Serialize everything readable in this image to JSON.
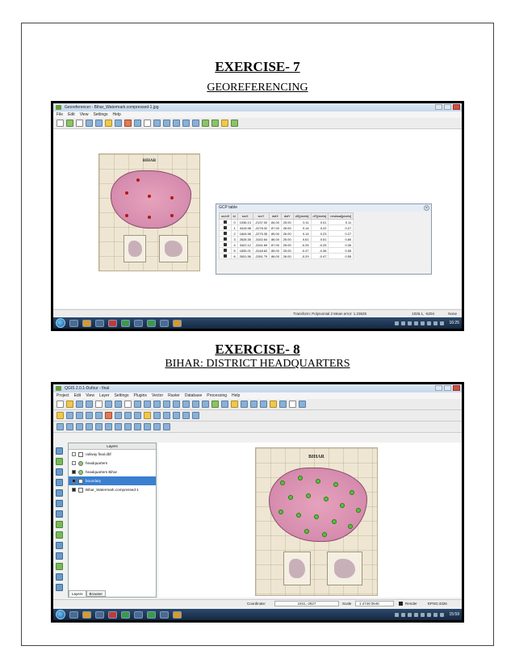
{
  "exercise7": {
    "title": "EXERCISE- 7",
    "subtitle": "GEOREFERENCING",
    "window_title": "Georeferencer - Bihar_Watermark.compressed-1.jpg",
    "menu": [
      "File",
      "Edit",
      "View",
      "Settings",
      "Help"
    ],
    "map": {
      "heading": "BIHAR"
    },
    "gcp_table": {
      "title": "GCP table",
      "columns": [
        "on/off",
        "id",
        "srcX",
        "srcY",
        "dstX",
        "dstY",
        "dX[pixels]",
        "dY[pixels]",
        "residual[pixels]"
      ],
      "rows": [
        [
          "0",
          "1036.13",
          "-2137.00",
          "84.00",
          "25.00",
          "0.11",
          "0.01",
          "0.11"
        ],
        [
          "1",
          "3415.98",
          "-2278.32",
          "87.00",
          "26.00",
          "0.14",
          "0.22",
          "0.27"
        ],
        [
          "2",
          "1844.98",
          "-2275.35",
          "85.00",
          "26.00",
          "0.14",
          "0.23",
          "0.27"
        ],
        [
          "3",
          "2628.35",
          "-3152.64",
          "86.00",
          "25.00",
          "0.61",
          "0.51",
          "0.80"
        ],
        [
          "4",
          "3422.12",
          "-3151.69",
          "87.00",
          "25.00",
          "-0.25",
          "-0.25",
          "0.35"
        ],
        [
          "5",
          "1835.21",
          "-3148.62",
          "85.00",
          "25.00",
          "-0.47",
          "-0.38",
          "0.55"
        ],
        [
          "6",
          "2631.56",
          "-2281.79",
          "86.00",
          "26.00",
          "-0.29",
          "-0.47",
          "0.55"
        ]
      ]
    },
    "status": {
      "transform": "Transform: Polynomial 2 Mean error: 1.23625",
      "coords": "1026.1, -5204",
      "crs": "None"
    },
    "clock": "16:25"
  },
  "exercise8": {
    "title": "EXERCISE- 8",
    "subtitle": "BIHAR: DISTRICT HEADQUARTERS",
    "window_title": "QGIS 2.0.1-Dufour - final",
    "menu": [
      "Project",
      "Edit",
      "View",
      "Layer",
      "Settings",
      "Plugins",
      "Vector",
      "Raster",
      "Database",
      "Processing",
      "Help"
    ],
    "layers_panel": {
      "title": "Layers",
      "layers": [
        {
          "name": "railway final.dbf",
          "checked": false,
          "selected": false
        },
        {
          "name": "headquarters",
          "checked": false,
          "selected": false
        },
        {
          "name": "headquarters Bihar",
          "checked": true,
          "selected": false
        },
        {
          "name": "boundary",
          "checked": true,
          "selected": true
        },
        {
          "name": "Bihar_Watermark.compressed-1",
          "checked": true,
          "selected": false
        }
      ],
      "tabs": [
        "Layers",
        "Browser"
      ]
    },
    "map": {
      "heading": "BIHAR"
    },
    "status": {
      "coordinate_label": "Coordinate:",
      "coordinate_value": "1841,-2827",
      "scale_label": "Scale",
      "scale_value": "1:4746'3648",
      "render_label": "Render",
      "crs": "EPSG:4326"
    },
    "clock": "15:59"
  }
}
